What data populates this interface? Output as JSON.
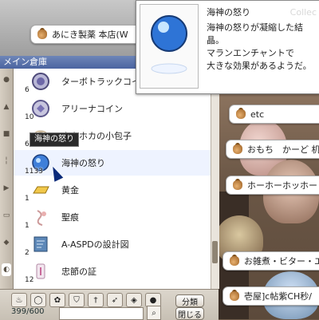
{
  "colors": {
    "accent": "#4b64a0",
    "window_bg": "#dcd6cc",
    "text": "#222222"
  },
  "shop_signs": [
    {
      "text": "あにき製薬 本店(W",
      "icon": "money-bag-icon"
    },
    {
      "text": "etc",
      "icon": "money-bag-icon"
    },
    {
      "text": "おもち　かーど 机",
      "icon": "money-bag-icon"
    },
    {
      "text": "ホーホーホッホー　ホー",
      "icon": "money-bag-icon"
    },
    {
      "text": "お雑煮・ビター・エル",
      "icon": "money-bag-icon"
    },
    {
      "text": "壱屋]c帖紫CH秒/",
      "icon": "money-bag-icon"
    }
  ],
  "inventory": {
    "title": "メイン倉庫",
    "items": [
      {
        "name": "ターボトラックコイン",
        "qty": "6",
        "icon": "coin-icon"
      },
      {
        "name": "アリーナコイン",
        "qty": "10",
        "icon": "coin-icon"
      },
      {
        "name": "ホカホカの小包子",
        "qty": "6",
        "icon": "bun-icon"
      },
      {
        "name": "海神の怒り",
        "qty": "1133",
        "icon": "blue-orb-icon"
      },
      {
        "name": "黄金",
        "qty": "1",
        "icon": "gold-bar-icon"
      },
      {
        "name": "聖痕",
        "qty": "1",
        "icon": "stigma-icon"
      },
      {
        "name": "A-ASPDの設計図",
        "qty": "2",
        "icon": "blueprint-icon"
      },
      {
        "name": "忠節の証",
        "qty": "12",
        "icon": "token-icon"
      }
    ],
    "tooltip": "海神の怒り",
    "count": "399/600",
    "sort_label": "分類",
    "close_label": "閉じる",
    "search_value": ""
  },
  "description": {
    "title": "海神の怒り",
    "lines": [
      "海神の怒りが凝縮した結晶。",
      "マランエンチャントで",
      "大きな効果があるようだ。"
    ],
    "watermark": "Collec",
    "icon": "blue-orb-icon"
  }
}
